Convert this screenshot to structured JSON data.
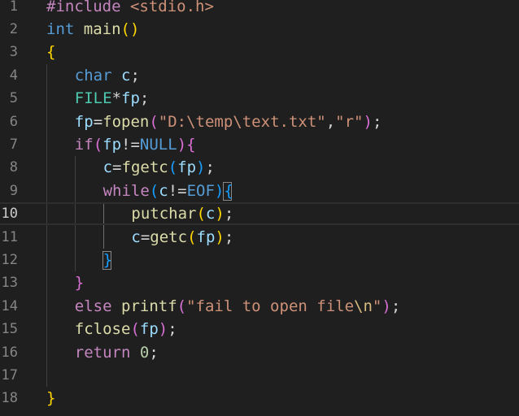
{
  "editor": {
    "colors": {
      "background": "#1f1f1f",
      "line_number": "#858585",
      "line_number_active": "#cccccc",
      "keyword": "#569cd6",
      "control": "#c586c0",
      "function": "#dcdcaa",
      "variable": "#9cdcfe",
      "type": "#4ec9b0",
      "string": "#ce9178",
      "number": "#b5cea8",
      "bracket_1": "#ffd700",
      "bracket_2": "#da70d6",
      "bracket_3": "#179fff"
    },
    "active_line": 10,
    "lines": [
      {
        "n": "1",
        "indent": 0,
        "tokens": [
          [
            "pre",
            "#include"
          ],
          [
            "p",
            " "
          ],
          [
            "inc",
            "<stdio.h>"
          ]
        ]
      },
      {
        "n": "2",
        "indent": 0,
        "tokens": [
          [
            "kw",
            "int"
          ],
          [
            "p",
            " "
          ],
          [
            "fn",
            "main"
          ],
          [
            "b1",
            "()"
          ]
        ]
      },
      {
        "n": "3",
        "indent": 0,
        "tokens": [
          [
            "b1",
            "{"
          ]
        ]
      },
      {
        "n": "4",
        "indent": 1,
        "tokens": [
          [
            "kw",
            "char"
          ],
          [
            "p",
            " "
          ],
          [
            "var",
            "c"
          ],
          [
            "p",
            ";"
          ]
        ]
      },
      {
        "n": "5",
        "indent": 1,
        "tokens": [
          [
            "type",
            "FILE"
          ],
          [
            "p",
            "*"
          ],
          [
            "var",
            "fp"
          ],
          [
            "p",
            ";"
          ]
        ]
      },
      {
        "n": "6",
        "indent": 1,
        "tokens": [
          [
            "var",
            "fp"
          ],
          [
            "p",
            "="
          ],
          [
            "fn",
            "fopen"
          ],
          [
            "b2",
            "("
          ],
          [
            "str",
            "\"D:\\temp\\text.txt\""
          ],
          [
            "p",
            ","
          ],
          [
            "str",
            "\"r\""
          ],
          [
            "b2",
            ")"
          ],
          [
            "p",
            ";"
          ]
        ]
      },
      {
        "n": "7",
        "indent": 1,
        "tokens": [
          [
            "ctl",
            "if"
          ],
          [
            "b2",
            "("
          ],
          [
            "var",
            "fp"
          ],
          [
            "p",
            "!="
          ],
          [
            "mac",
            "NULL"
          ],
          [
            "b2",
            ")"
          ],
          [
            "b2",
            "{"
          ]
        ]
      },
      {
        "n": "8",
        "indent": 2,
        "tokens": [
          [
            "var",
            "c"
          ],
          [
            "p",
            "="
          ],
          [
            "fn",
            "fgetc"
          ],
          [
            "b3",
            "("
          ],
          [
            "var",
            "fp"
          ],
          [
            "b3",
            ")"
          ],
          [
            "p",
            ";"
          ]
        ]
      },
      {
        "n": "9",
        "indent": 2,
        "tokens": [
          [
            "ctl",
            "while"
          ],
          [
            "b3",
            "("
          ],
          [
            "var",
            "c"
          ],
          [
            "p",
            "!="
          ],
          [
            "mac",
            "EOF"
          ],
          [
            "b3",
            ")"
          ],
          [
            "b3",
            "{"
          ]
        ]
      },
      {
        "n": "10",
        "indent": 3,
        "tokens": [
          [
            "fn",
            "putchar"
          ],
          [
            "b1",
            "("
          ],
          [
            "var",
            "c"
          ],
          [
            "b1",
            ")"
          ],
          [
            "p",
            ";"
          ]
        ]
      },
      {
        "n": "11",
        "indent": 3,
        "tokens": [
          [
            "var",
            "c"
          ],
          [
            "p",
            "="
          ],
          [
            "fn",
            "getc"
          ],
          [
            "b1",
            "("
          ],
          [
            "var",
            "fp"
          ],
          [
            "b1",
            ")"
          ],
          [
            "p",
            ";"
          ]
        ]
      },
      {
        "n": "12",
        "indent": 2,
        "tokens": [
          [
            "b3",
            "}"
          ]
        ]
      },
      {
        "n": "13",
        "indent": 1,
        "tokens": [
          [
            "b2",
            "}"
          ]
        ]
      },
      {
        "n": "14",
        "indent": 1,
        "tokens": [
          [
            "ctl",
            "else"
          ],
          [
            "p",
            " "
          ],
          [
            "fn",
            "printf"
          ],
          [
            "b2",
            "("
          ],
          [
            "str",
            "\"fail to open file"
          ],
          [
            "esc",
            "\\n"
          ],
          [
            "str",
            "\""
          ],
          [
            "b2",
            ")"
          ],
          [
            "p",
            ";"
          ]
        ]
      },
      {
        "n": "15",
        "indent": 1,
        "tokens": [
          [
            "fn",
            "fclose"
          ],
          [
            "b2",
            "("
          ],
          [
            "var",
            "fp"
          ],
          [
            "b2",
            ")"
          ],
          [
            "p",
            ";"
          ]
        ]
      },
      {
        "n": "16",
        "indent": 1,
        "tokens": [
          [
            "ctl",
            "return"
          ],
          [
            "p",
            " "
          ],
          [
            "num",
            "0"
          ],
          [
            "p",
            ";"
          ]
        ]
      },
      {
        "n": "17",
        "indent": 0,
        "tokens": []
      },
      {
        "n": "18",
        "indent": 0,
        "tokens": [
          [
            "b1",
            "}"
          ]
        ]
      }
    ]
  }
}
